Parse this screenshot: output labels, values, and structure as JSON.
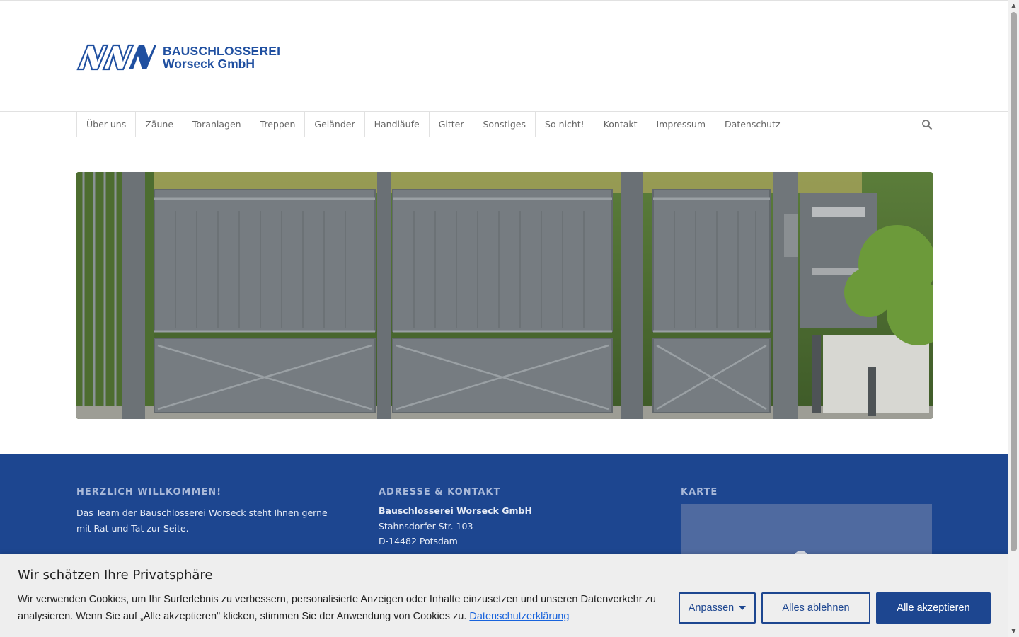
{
  "brand": {
    "line1": "BAUSCHLOSSEREI",
    "line2": "Worseck GmbH",
    "color": "#1f4fa0"
  },
  "nav": {
    "items": [
      "Über uns",
      "Zäune",
      "Toranlagen",
      "Treppen",
      "Geländer",
      "Handläufe",
      "Gitter",
      "Sonstiges",
      "So nicht!",
      "Kontakt",
      "Impressum",
      "Datenschutz"
    ],
    "search_icon": "search-icon"
  },
  "footer": {
    "background": "#1d4690",
    "welcome": {
      "title": "HERZLICH WILLKOMMEN!",
      "text_line1": "Das Team der Bauschlosserei Worseck steht Ihnen gerne",
      "text_line2": "mit Rat und Tat zur Seite."
    },
    "contact": {
      "title": "ADRESSE & KONTAKT",
      "company": "Bauschlosserei Worseck GmbH",
      "street": "Stahnsdorfer Str. 103",
      "city": "D-14482 Potsdam"
    },
    "map": {
      "title": "KARTE",
      "icon": "map-pin-icon"
    }
  },
  "cookie": {
    "title": "Wir schätzen Ihre Privatsphäre",
    "text": "Wir verwenden Cookies, um Ihr Surferlebnis zu verbessern, personalisierte Anzeigen oder Inhalte einzusetzen und unseren Datenverkehr zu analysieren. Wenn Sie auf „Alle akzeptieren\" klicken, stimmen Sie der Anwendung von Cookies zu.",
    "link": "Datenschutzerklärung",
    "customize": "Anpassen",
    "reject": "Alles ablehnen",
    "accept": "Alle akzeptieren"
  }
}
